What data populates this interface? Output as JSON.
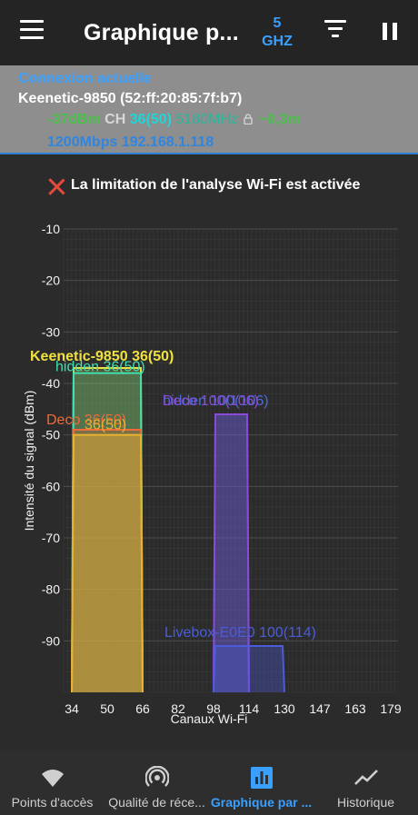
{
  "topbar": {
    "title": "Graphique p...",
    "band_number": "5",
    "band_unit": "GHZ"
  },
  "connection": {
    "header": "Connexion actuelle",
    "ssid_mac": "Keenetic-9850 (52:ff:20:85:7f:b7)",
    "signal": "-37dBm",
    "ch_label": "CH",
    "channel": "36(50)",
    "frequency": "5180MHz",
    "distance": "~0,3m",
    "speed_ip": "1200Mbps 192.168.1.118"
  },
  "warning": {
    "text": "La limitation de l'analyse Wi-Fi est activée"
  },
  "chart_data": {
    "type": "area",
    "xlabel": "Canaux Wi-Fi",
    "ylabel": "Intensité du signal (dBm)",
    "ylim": [
      -100,
      -10
    ],
    "yticks": [
      -10,
      -20,
      -30,
      -40,
      -50,
      -60,
      -70,
      -80,
      -90
    ],
    "xticks": [
      "34",
      "50",
      "66",
      "82",
      "98",
      "114",
      "130",
      "147",
      "163",
      "179"
    ],
    "grid": true,
    "networks": [
      {
        "label": "Keenetic-9850 36(50)",
        "x_start": 34,
        "x_end": 66,
        "level": -37,
        "color": "#f0e040"
      },
      {
        "label": "hidden 36(50)",
        "x_start": 34,
        "x_end": 66,
        "level": -38,
        "color": "#40e0b0"
      },
      {
        "label": "Deco 36(50)",
        "x_start": 34,
        "x_end": 66,
        "level": -49,
        "color": "#f06a3a"
      },
      {
        "label": "36(50)",
        "x_start": 34,
        "x_end": 66,
        "level": -50,
        "color": "#e8b430"
      },
      {
        "label": "hidden 100(106)",
        "x_start": 98,
        "x_end": 114,
        "level": -46,
        "color": "#4a6cd8"
      },
      {
        "label": "Deco 100(106)",
        "x_start": 98,
        "x_end": 114,
        "level": -46,
        "color": "#8a4ad8"
      },
      {
        "label": "Livebox-E0E0 100(114)",
        "x_start": 98,
        "x_end": 130,
        "level": -91,
        "color": "#4a5cd8"
      }
    ]
  },
  "nav": {
    "items": [
      {
        "label": "Points d'accès",
        "icon": "wifi-icon"
      },
      {
        "label": "Qualité de réce...",
        "icon": "signal-rings-icon"
      },
      {
        "label": "Graphique par ...",
        "icon": "bar-chart-icon"
      },
      {
        "label": "Historique",
        "icon": "trend-line-icon"
      }
    ]
  },
  "colors": {
    "accent": "#3aa0ff",
    "signal_green": "#4cc04c",
    "channel_cyan": "#1ed6d6",
    "frequency_teal": "#2bb59a",
    "warning_red": "#e34a3c"
  }
}
